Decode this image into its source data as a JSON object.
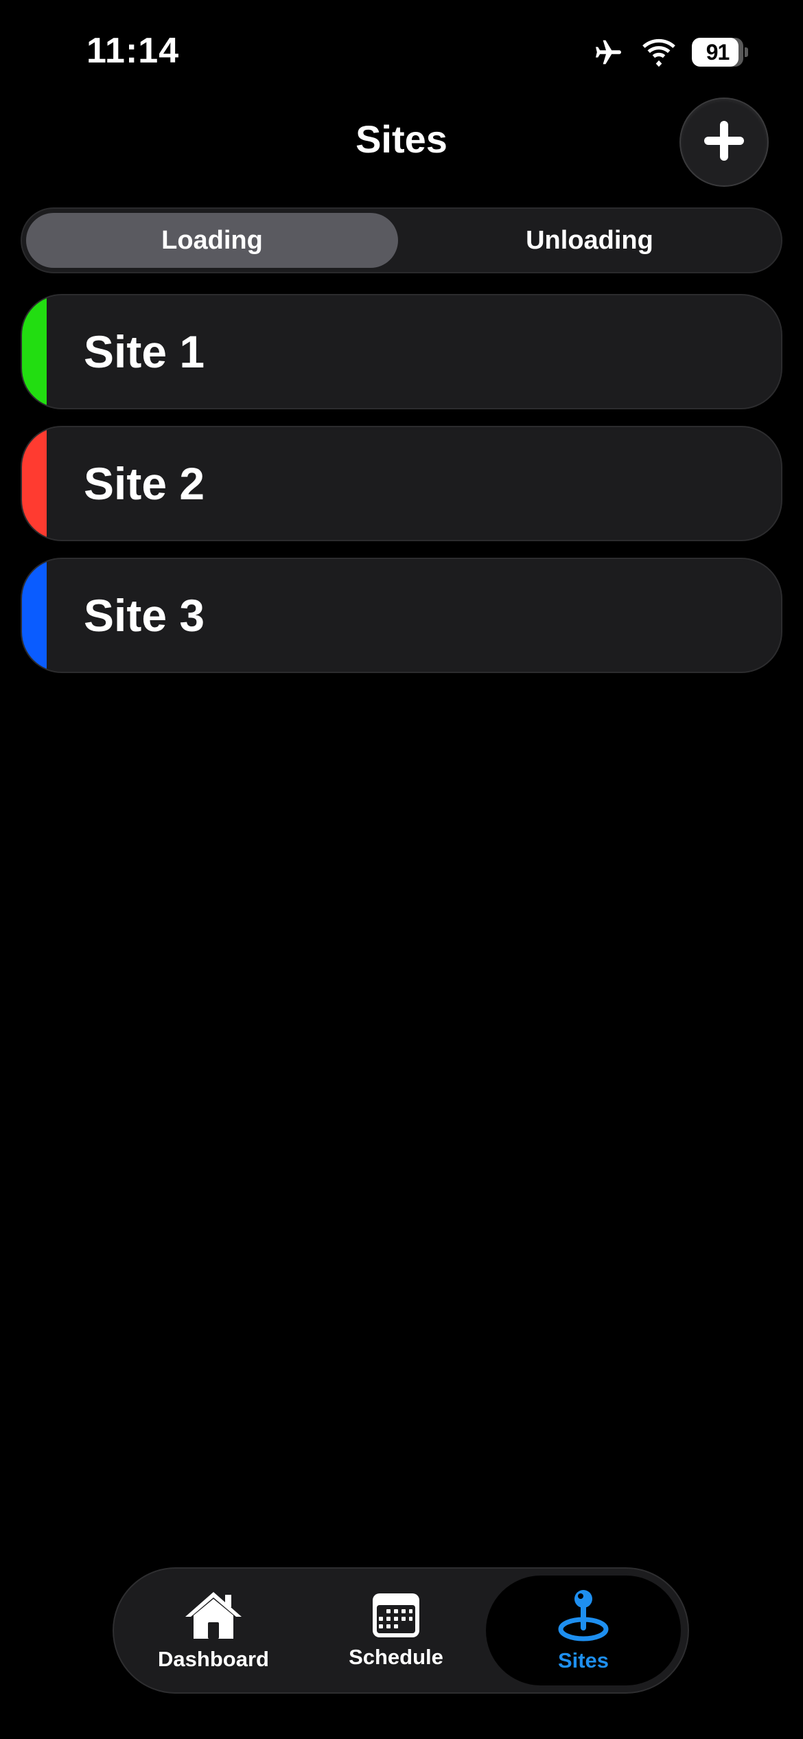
{
  "status_bar": {
    "time": "11:14",
    "battery_level": "91",
    "battery_fraction": 0.91
  },
  "header": {
    "title": "Sites",
    "add_icon": "plus-icon"
  },
  "segmented_control": {
    "selected_label": "Loading",
    "other_label": "Unloading"
  },
  "sites": [
    {
      "name": "Site 1",
      "color": "#22dd11"
    },
    {
      "name": "Site 2",
      "color": "#ff3b30"
    },
    {
      "name": "Site 3",
      "color": "#0a5cff"
    }
  ],
  "tab_bar": {
    "tabs": [
      {
        "label": "Dashboard",
        "icon": "house-icon",
        "active": false
      },
      {
        "label": "Schedule",
        "icon": "calendar-icon",
        "active": false
      },
      {
        "label": "Sites",
        "icon": "location-pin-icon",
        "active": true
      }
    ],
    "active_color": "#1e8ff0"
  }
}
